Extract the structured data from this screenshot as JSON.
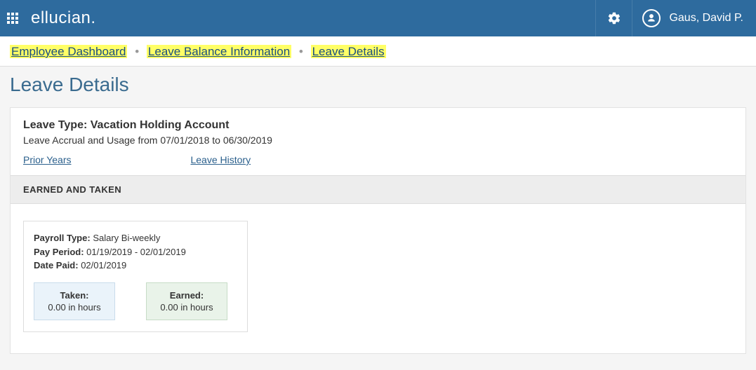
{
  "banner": {
    "brand": "ellucian.",
    "username": "Gaus, David P."
  },
  "breadcrumb": {
    "items": [
      {
        "label": "Employee Dashboard"
      },
      {
        "label": "Leave Balance Information"
      },
      {
        "label": "Leave Details"
      }
    ]
  },
  "page": {
    "title": "Leave Details"
  },
  "leave": {
    "type_prefix": "Leave Type:",
    "type_value": "Vacation Holding Account",
    "range_text": "Leave Accrual and Usage from 07/01/2018 to 06/30/2019",
    "links": {
      "prior_years": "Prior Years",
      "leave_history": "Leave History"
    }
  },
  "section": {
    "earned_taken": "EARNED AND TAKEN"
  },
  "pay_card": {
    "payroll_label": "Payroll Type:",
    "payroll_value": "Salary Bi-weekly",
    "period_label": "Pay Period:",
    "period_value": "01/19/2019 - 02/01/2019",
    "paid_label": "Date Paid:",
    "paid_value": "02/01/2019",
    "taken": {
      "label": "Taken:",
      "value": "0.00 in hours"
    },
    "earned": {
      "label": "Earned:",
      "value": "0.00 in hours"
    }
  }
}
